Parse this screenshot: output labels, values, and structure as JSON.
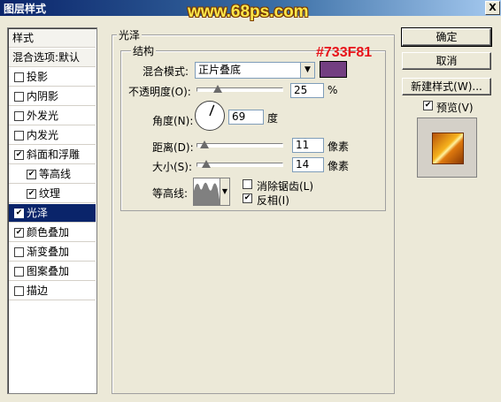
{
  "window": {
    "title": "图层样式",
    "watermark": "www.68ps.com",
    "close_label": "X"
  },
  "style_list": {
    "header": "样式",
    "blend_options": "混合选项:默认",
    "items": [
      {
        "label": "投影",
        "checked": false,
        "indent": false,
        "selected": false
      },
      {
        "label": "内阴影",
        "checked": false,
        "indent": false,
        "selected": false
      },
      {
        "label": "外发光",
        "checked": false,
        "indent": false,
        "selected": false
      },
      {
        "label": "内发光",
        "checked": false,
        "indent": false,
        "selected": false
      },
      {
        "label": "斜面和浮雕",
        "checked": true,
        "indent": false,
        "selected": false
      },
      {
        "label": "等高线",
        "checked": true,
        "indent": true,
        "selected": false
      },
      {
        "label": "纹理",
        "checked": true,
        "indent": true,
        "selected": false
      },
      {
        "label": "光泽",
        "checked": true,
        "indent": false,
        "selected": true
      },
      {
        "label": "颜色叠加",
        "checked": true,
        "indent": false,
        "selected": false
      },
      {
        "label": "渐变叠加",
        "checked": false,
        "indent": false,
        "selected": false
      },
      {
        "label": "图案叠加",
        "checked": false,
        "indent": false,
        "selected": false
      },
      {
        "label": "描边",
        "checked": false,
        "indent": false,
        "selected": false
      }
    ]
  },
  "satin": {
    "group_title": "光泽",
    "structure_title": "结构",
    "blend_mode_label": "混合模式:",
    "blend_mode_value": "正片叠底",
    "color_hex_label": "#733F81",
    "color": "#733f81",
    "opacity_label": "不透明度(O):",
    "opacity_value": "25",
    "opacity_unit": "%",
    "angle_label": "角度(N):",
    "angle_value": "69",
    "angle_unit": "度",
    "distance_label": "距离(D):",
    "distance_value": "11",
    "distance_unit": "像素",
    "size_label": "大小(S):",
    "size_value": "14",
    "size_unit": "像素",
    "contour_label": "等高线:",
    "antialias_label": "消除锯齿(L)",
    "antialias_checked": false,
    "invert_label": "反相(I)",
    "invert_checked": true
  },
  "buttons": {
    "ok": "确定",
    "cancel": "取消",
    "new_style": "新建样式(W)...",
    "preview_label": "预览(V)",
    "preview_checked": true
  }
}
